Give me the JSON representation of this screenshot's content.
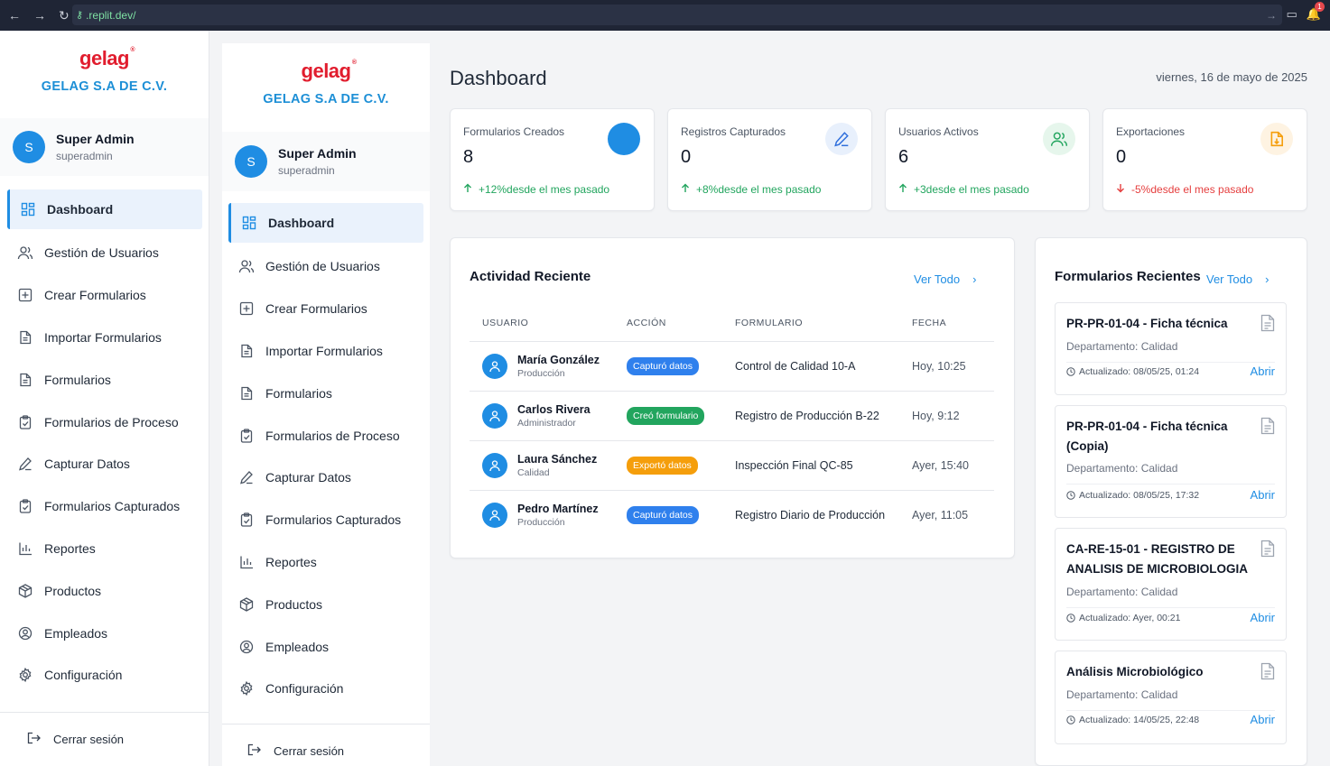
{
  "browser": {
    "url": ".replit.dev/",
    "notification_count": "1"
  },
  "brand": {
    "logo": "gelag",
    "company": "GELAG S.A DE C.V."
  },
  "user": {
    "initial": "S",
    "name": "Super Admin",
    "role": "superadmin"
  },
  "menu": [
    {
      "label": "Dashboard",
      "icon": "dashboard-grid-icon",
      "active": true
    },
    {
      "label": "Gestión de Usuarios",
      "icon": "users-icon"
    },
    {
      "label": "Crear Formularios",
      "icon": "plus-square-icon"
    },
    {
      "label": "Importar Formularios",
      "icon": "file-text-icon"
    },
    {
      "label": "Formularios",
      "icon": "file-text-icon"
    },
    {
      "label": "Formularios de Proceso",
      "icon": "clipboard-check-icon"
    },
    {
      "label": "Capturar Datos",
      "icon": "pencil-icon"
    },
    {
      "label": "Formularios Capturados",
      "icon": "clipboard-check-icon"
    },
    {
      "label": "Reportes",
      "icon": "bar-chart-icon"
    },
    {
      "label": "Productos",
      "icon": "package-icon"
    },
    {
      "label": "Empleados",
      "icon": "user-circle-icon"
    },
    {
      "label": "Configuración",
      "icon": "gear-icon"
    }
  ],
  "logout": "Cerrar sesión",
  "header": {
    "title": "Dashboard",
    "date": "viernes, 16 de mayo de 2025"
  },
  "stats": [
    {
      "label": "Formularios Creados",
      "value": "8",
      "trend": "+12%desde el mes pasado",
      "direction": "up",
      "color": "#1f8de3",
      "icon": "circle-icon"
    },
    {
      "label": "Registros Capturados",
      "value": "0",
      "trend": "+8%desde el mes pasado",
      "direction": "up",
      "color": "#e8f0fc",
      "icon": "pencil-icon"
    },
    {
      "label": "Usuarios Activos",
      "value": "6",
      "trend": "+3desde el mes pasado",
      "direction": "up",
      "color": "#e6f6ec",
      "icon": "users-icon"
    },
    {
      "label": "Exportaciones",
      "value": "0",
      "trend": "-5%desde el mes pasado",
      "direction": "down",
      "color": "#fef3e2",
      "icon": "file-download-icon"
    }
  ],
  "activity": {
    "title": "Actividad Reciente",
    "view_all": "Ver Todo",
    "columns": [
      "USUARIO",
      "ACCIÓN",
      "FORMULARIO",
      "FECHA"
    ],
    "rows": [
      {
        "name": "María González",
        "dept": "Producción",
        "action": "Capturó datos",
        "action_color": "blue",
        "form": "Control de Calidad 10-A",
        "date": "Hoy, 10:25"
      },
      {
        "name": "Carlos Rivera",
        "dept": "Administrador",
        "action": "Creó formulario",
        "action_color": "green",
        "form": "Registro de Producción B-22",
        "date": "Hoy, 9:12"
      },
      {
        "name": "Laura Sánchez",
        "dept": "Calidad",
        "action": "Exportó datos",
        "action_color": "orange",
        "form": "Inspección Final QC-85",
        "date": "Ayer, 15:40"
      },
      {
        "name": "Pedro Martínez",
        "dept": "Producción",
        "action": "Capturó datos",
        "action_color": "blue",
        "form": "Registro Diario de Producción",
        "date": "Ayer, 11:05"
      }
    ]
  },
  "recent_forms": {
    "title": "Formularios Recientes",
    "view_all": "Ver Todo",
    "open_label": "Abrir",
    "items": [
      {
        "title": "PR-PR-01-04 - Ficha técnica",
        "dept": "Departamento: Calidad",
        "updated": "Actualizado: 08/05/25, 01:24"
      },
      {
        "title": "PR-PR-01-04 - Ficha técnica (Copia)",
        "dept": "Departamento: Calidad",
        "updated": "Actualizado: 08/05/25, 17:32"
      },
      {
        "title": "CA-RE-15-01 - REGISTRO DE ANALISIS DE MICROBIOLOGIA",
        "dept": "Departamento: Calidad",
        "updated": "Actualizado: Ayer, 00:21"
      },
      {
        "title": "Análisis Microbiológico",
        "dept": "Departamento: Calidad",
        "updated": "Actualizado: 14/05/25, 22:48"
      }
    ]
  }
}
